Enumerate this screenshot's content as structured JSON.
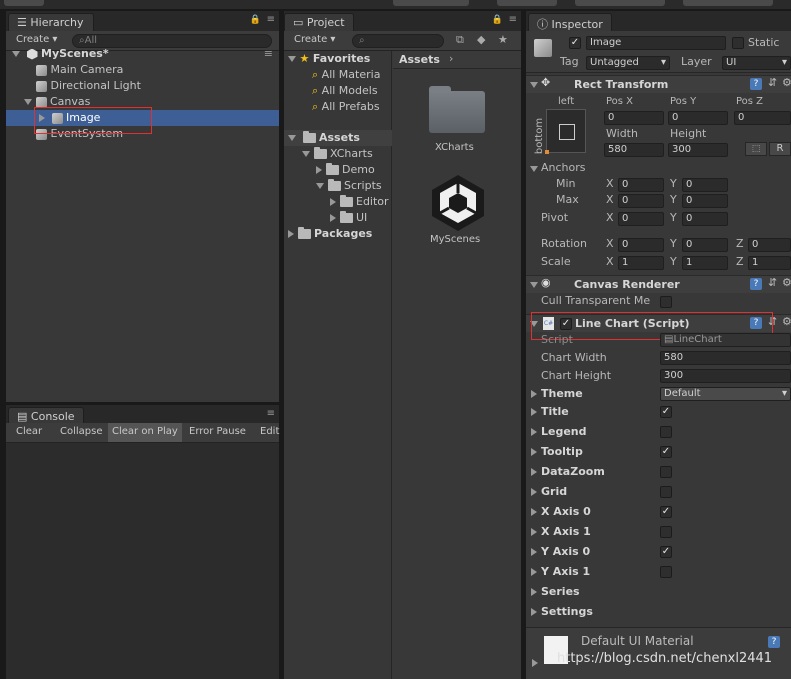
{
  "hierarchy": {
    "tab": "Hierarchy",
    "create": "Create",
    "search_placeholder": "All",
    "scene": "MyScenes*",
    "items": [
      "Main Camera",
      "Directional Light",
      "Canvas",
      "Image",
      "EventSystem"
    ]
  },
  "console": {
    "tab": "Console",
    "buttons": [
      "Clear",
      "Collapse",
      "Clear on Play",
      "Error Pause",
      "Edit"
    ]
  },
  "project": {
    "tab": "Project",
    "create": "Create",
    "favorites": "Favorites",
    "fav_items": [
      "All Materia",
      "All Models",
      "All Prefabs"
    ],
    "assets": "Assets",
    "tree": [
      "XCharts",
      "Demo",
      "Scripts",
      "Editor",
      "UI"
    ],
    "packages": "Packages",
    "breadcrumb": "Assets",
    "grid_items": [
      "XCharts",
      "MyScenes"
    ]
  },
  "inspector": {
    "tab": "Inspector",
    "object_name": "Image",
    "static_label": "Static",
    "tag_label": "Tag",
    "tag_value": "Untagged",
    "layer_label": "Layer",
    "layer_value": "UI",
    "rect_transform": {
      "title": "Rect Transform",
      "anchor_h": "left",
      "anchor_v": "bottom",
      "posx_label": "Pos X",
      "posy_label": "Pos Y",
      "posz_label": "Pos Z",
      "posx": "0",
      "posy": "0",
      "posz": "0",
      "width_label": "Width",
      "height_label": "Height",
      "width": "580",
      "height": "300",
      "r_btn": "R",
      "anchors": "Anchors",
      "min": "Min",
      "max": "Max",
      "pivot": "Pivot",
      "x": "X",
      "y": "Y",
      "z": "Z",
      "min_x": "0",
      "min_y": "0",
      "max_x": "0",
      "max_y": "0",
      "pivot_x": "0",
      "pivot_y": "0",
      "rotation": "Rotation",
      "rot_x": "0",
      "rot_y": "0",
      "rot_z": "0",
      "scale": "Scale",
      "scale_x": "1",
      "scale_y": "1",
      "scale_z": "1"
    },
    "canvas_renderer": {
      "title": "Canvas Renderer",
      "cull": "Cull Transparent Me"
    },
    "line_chart": {
      "title": "Line Chart (Script)",
      "script_label": "Script",
      "script_value": "LineChart",
      "chart_width_label": "Chart Width",
      "chart_width": "580",
      "chart_height_label": "Chart Height",
      "chart_height": "300",
      "theme_label": "Theme",
      "theme_value": "Default",
      "toggles": [
        {
          "label": "Title",
          "checked": true
        },
        {
          "label": "Legend",
          "checked": false
        },
        {
          "label": "Tooltip",
          "checked": true
        },
        {
          "label": "DataZoom",
          "checked": false
        },
        {
          "label": "Grid",
          "checked": false
        },
        {
          "label": "X Axis 0",
          "checked": true
        },
        {
          "label": "X Axis 1",
          "checked": false
        },
        {
          "label": "Y Axis 0",
          "checked": true
        },
        {
          "label": "Y Axis 1",
          "checked": false
        }
      ],
      "series": "Series",
      "settings": "Settings"
    },
    "material": "Default UI Material"
  },
  "watermark": "https://blog.csdn.net/chenxl2441"
}
